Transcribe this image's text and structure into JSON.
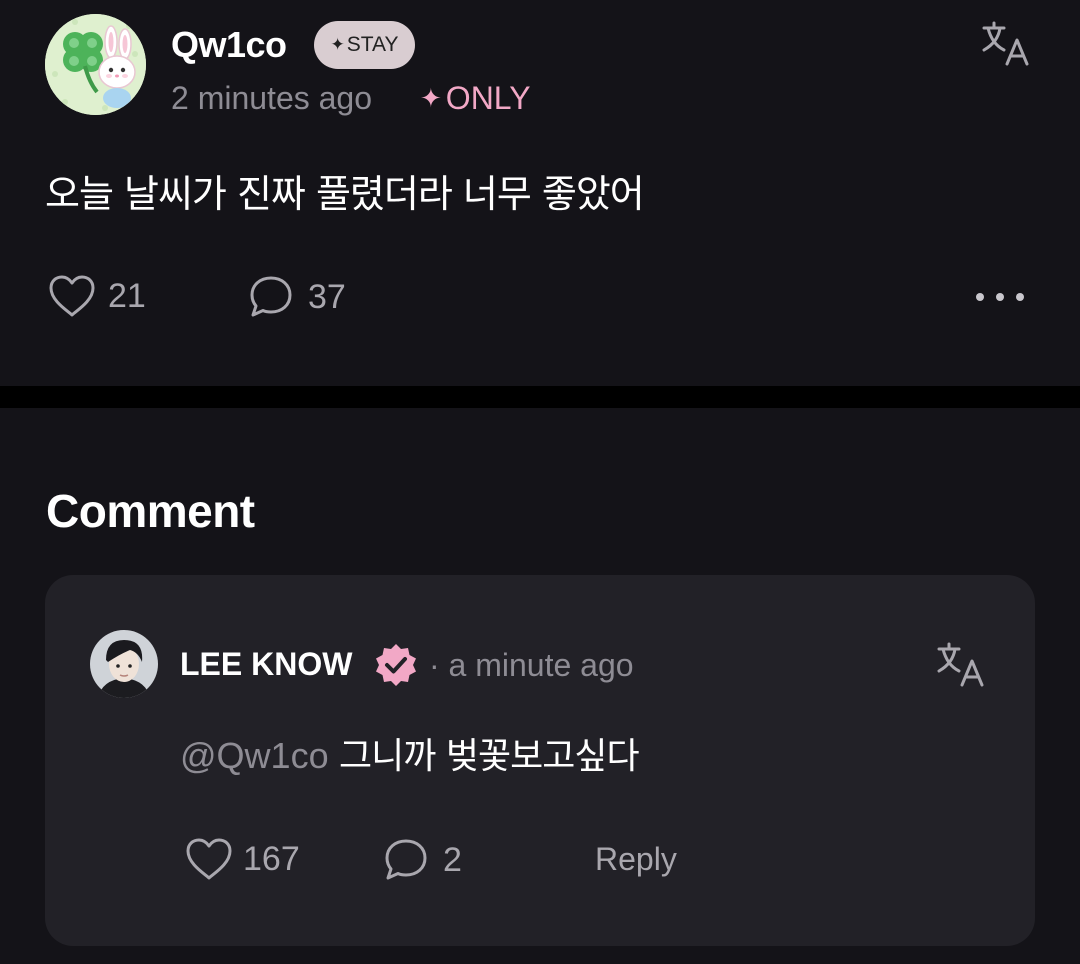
{
  "post": {
    "username": "Qw1co",
    "badge": {
      "icon": "sparkle-icon",
      "label": "STAY"
    },
    "time": "2 minutes ago",
    "visibility": {
      "icon": "sparkle-icon",
      "label": "ONLY",
      "color": "#f2a8c6"
    },
    "text": "오늘 날씨가 진짜 풀렸더라 너무 좋았어",
    "likes": "21",
    "comments": "37",
    "icons": {
      "translate": "translate-icon",
      "like": "heart-outline-icon",
      "comment": "speech-bubble-icon",
      "more": "more-dots-icon"
    }
  },
  "comments_section": {
    "title": "Comment",
    "items": [
      {
        "author": "LEE KNOW",
        "verified_icon": "verified-badge-icon",
        "verified_color": "#f2a8c6",
        "meta": "· a minute ago",
        "mention": "@Qw1co",
        "text": "그니까 벚꽃보고싶다",
        "likes": "167",
        "replies": "2",
        "reply_label": "Reply"
      }
    ]
  },
  "colors": {
    "background": "#141318",
    "card": "#222127",
    "muted_text": "#8e8c94",
    "accent_pink": "#f2a8c6"
  }
}
